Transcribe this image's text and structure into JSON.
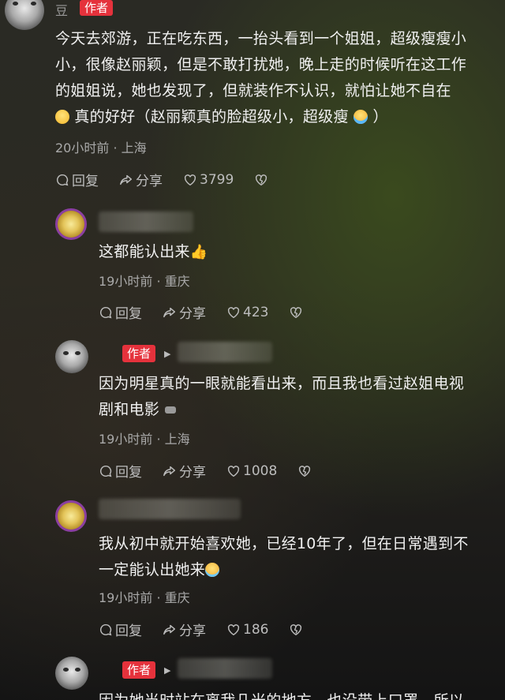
{
  "comment1": {
    "name_partial": "豆",
    "author_tag": "作者",
    "lines": [
      "今天去郊游，正在吃东西，一抬头看到一个姐姐，超级瘦瘦小",
      "小，很像赵丽颖，但是不敢打扰她，晚上走的时候听在这工作",
      "的姐姐说，她也发现了，但就装作不认识，就怕让她不自在",
      "真的好好（赵丽颖真的脸超级小，超级瘦",
      "）"
    ],
    "time": "20小时前 · 上海",
    "reply": "回复",
    "share": "分享",
    "likes": "3799"
  },
  "comment2": {
    "text": "这都能认出来",
    "time": "19小时前 · 重庆",
    "reply": "回复",
    "share": "分享",
    "likes": "423"
  },
  "comment3": {
    "author_tag": "作者",
    "lines": [
      "因为明星真的一眼就能看出来，而且我也看过赵姐电视",
      "剧和电影"
    ],
    "time": "19小时前 · 上海",
    "reply": "回复",
    "share": "分享",
    "likes": "1008"
  },
  "comment4": {
    "lines": [
      "我从初中就开始喜欢她，已经10年了，但在日常遇到不",
      "一定能认出她来"
    ],
    "time": "19小时前 · 重庆",
    "reply": "回复",
    "share": "分享",
    "likes": "186"
  },
  "comment5": {
    "author_tag": "作者",
    "partial_line": "因为她当时站在离我几米的地方，也没带上口罩，所以"
  },
  "icons": {
    "reply": "comment-bubble-icon",
    "share": "share-arrow-icon",
    "like": "heart-icon",
    "dislike": "broken-heart-icon"
  },
  "colors": {
    "author_tag": "#e5323c",
    "avatar_ring": "#8b3fa1"
  }
}
